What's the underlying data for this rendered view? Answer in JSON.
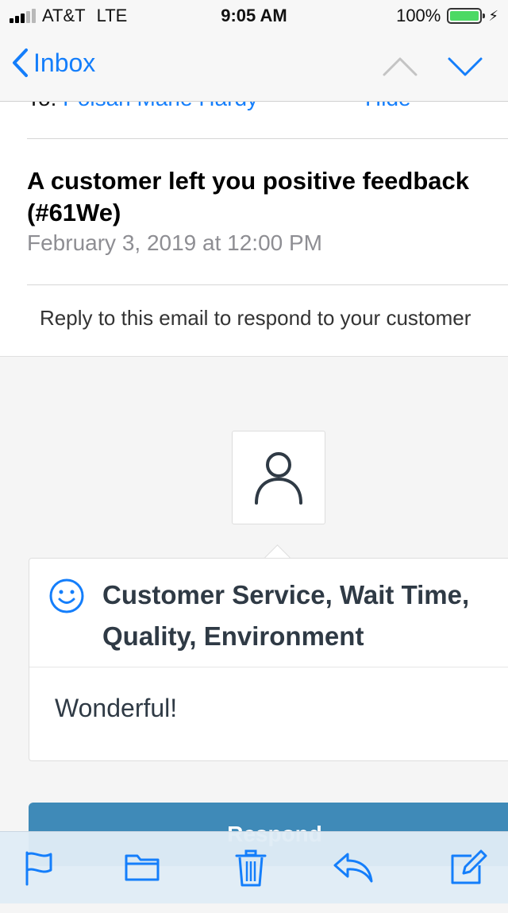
{
  "status_bar": {
    "carrier": "AT&T",
    "network": "LTE",
    "time": "9:05 AM",
    "battery": "100%"
  },
  "nav": {
    "back_label": "Inbox",
    "up_icon": "chevron-up-icon",
    "down_icon": "chevron-down-icon"
  },
  "header": {
    "to_label": "To:",
    "to_name": "Poisan Marie Hardy",
    "hide_label": "Hide",
    "subject": "A customer left you positive feedback (#61We)",
    "date": "February 3, 2019 at 12:00 PM"
  },
  "body": {
    "reply_note": "Reply to this email to respond to your customer",
    "avatar_icon": "person-icon",
    "sentiment_icon": "smiley-icon",
    "categories": "Customer Service, Wait Time, Quality, Environment",
    "comment": "Wonderful!",
    "cta_label": "Respond"
  },
  "toolbar": {
    "items": [
      "flag-icon",
      "folder-icon",
      "trash-icon",
      "reply-icon",
      "compose-icon"
    ]
  },
  "colors": {
    "accent": "#147efb",
    "cta": "#3f8ab8",
    "battery": "#4cd964",
    "card_text": "#2f3a45"
  }
}
